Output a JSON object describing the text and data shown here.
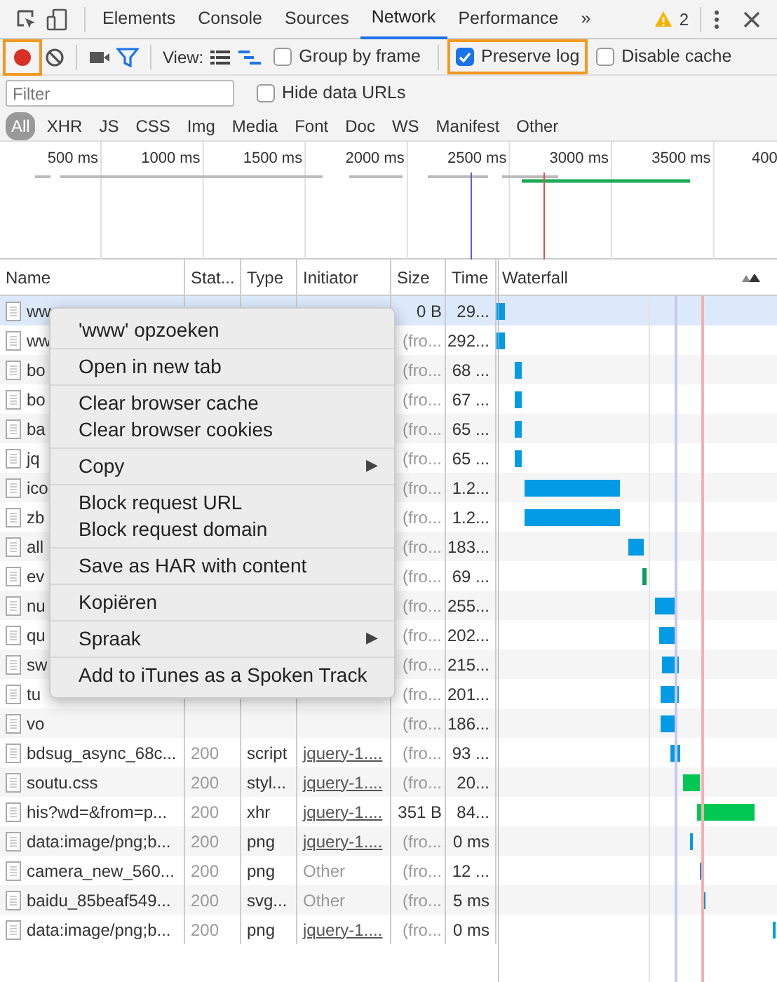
{
  "tabs": [
    {
      "label": "Elements",
      "selected": false
    },
    {
      "label": "Console",
      "selected": false
    },
    {
      "label": "Sources",
      "selected": false
    },
    {
      "label": "Network",
      "selected": true
    },
    {
      "label": "Performance",
      "selected": false
    }
  ],
  "more_tabs": "»",
  "warning_count": "2",
  "toolbar": {
    "record": {
      "highlighted": true
    },
    "view_label": "View:",
    "checkboxes": [
      {
        "label": "Group by frame",
        "checked": false,
        "highlighted": false
      },
      {
        "label": "Preserve log",
        "checked": true,
        "highlighted": true
      },
      {
        "label": "Disable cache",
        "checked": false,
        "highlighted": false
      }
    ]
  },
  "filter": {
    "placeholder": "Filter",
    "hide_data_urls": {
      "label": "Hide data URLs",
      "checked": false
    }
  },
  "type_filters": [
    {
      "label": "All",
      "selected": true
    },
    {
      "label": "XHR",
      "selected": false
    },
    {
      "label": "JS",
      "selected": false
    },
    {
      "label": "CSS",
      "selected": false
    },
    {
      "label": "Img",
      "selected": false
    },
    {
      "label": "Media",
      "selected": false
    },
    {
      "label": "Font",
      "selected": false
    },
    {
      "label": "Doc",
      "selected": false
    },
    {
      "label": "WS",
      "selected": false
    },
    {
      "label": "Manifest",
      "selected": false
    },
    {
      "label": "Other",
      "selected": false
    }
  ],
  "overview": {
    "ticks": [
      "500 ms",
      "1000 ms",
      "1500 ms",
      "2000 ms",
      "2500 ms",
      "3000 ms",
      "3500 ms",
      "400"
    ]
  },
  "table": {
    "columns": [
      "Name",
      "Stat...",
      "Type",
      "Initiator",
      "Size",
      "Time",
      "Waterfall"
    ],
    "rows": [
      {
        "name": "ww",
        "size": "0 B",
        "time": "29...",
        "selected": true
      },
      {
        "name": "ww",
        "size": "(fro...",
        "time": "292...",
        "selected": false
      },
      {
        "name": "bo",
        "size": "(fro...",
        "time": "68 ...",
        "selected": false
      },
      {
        "name": "bo",
        "size": "(fro...",
        "time": "67 ...",
        "selected": false
      },
      {
        "name": "ba",
        "size": "(fro...",
        "time": "65 ...",
        "selected": false
      },
      {
        "name": "jq",
        "size": "(fro...",
        "time": "65 ...",
        "selected": false
      },
      {
        "name": "ico",
        "size": "(fro...",
        "time": "1.2...",
        "selected": false
      },
      {
        "name": "zb",
        "size": "(fro...",
        "time": "1.2...",
        "selected": false
      },
      {
        "name": "all",
        "size": "(fro...",
        "time": "183...",
        "selected": false
      },
      {
        "name": "ev",
        "size": "(fro...",
        "time": "69 ...",
        "selected": false
      },
      {
        "name": "nu",
        "size": "(fro...",
        "time": "255...",
        "selected": false
      },
      {
        "name": "qu",
        "size": "(fro...",
        "time": "202...",
        "selected": false
      },
      {
        "name": "sw",
        "size": "(fro...",
        "time": "215...",
        "selected": false
      },
      {
        "name": "tu",
        "size": "(fro...",
        "time": "201...",
        "selected": false
      },
      {
        "name": "vo",
        "size": "(fro...",
        "time": "186...",
        "selected": false
      },
      {
        "name": "bdsug_async_68c...",
        "status": "200",
        "type": "script",
        "initiator": "jquery-1....",
        "size": "(fro...",
        "time": "93 ...",
        "selected": false
      },
      {
        "name": "soutu.css",
        "status": "200",
        "type": "styl...",
        "initiator": "jquery-1....",
        "size": "(fro...",
        "time": "20...",
        "selected": false
      },
      {
        "name": "his?wd=&from=p...",
        "status": "200",
        "type": "xhr",
        "initiator": "jquery-1....",
        "size": "351 B",
        "time": "84...",
        "selected": false
      },
      {
        "name": "data:image/png;b...",
        "status": "200",
        "type": "png",
        "initiator": "jquery-1....",
        "size": "(fro...",
        "time": "0 ms",
        "selected": false
      },
      {
        "name": "camera_new_560...",
        "status": "200",
        "type": "png",
        "initiator": "Other",
        "size": "(fro...",
        "time": "12 ...",
        "selected": false
      },
      {
        "name": "baidu_85beaf549...",
        "status": "200",
        "type": "svg...",
        "initiator": "Other",
        "size": "(fro...",
        "time": "5 ms",
        "selected": false
      },
      {
        "name": "data:image/png;b...",
        "status": "200",
        "type": "png",
        "initiator": "jquery-1....",
        "size": "(fro...",
        "time": "0 ms",
        "selected": false
      }
    ]
  },
  "context_menu": {
    "groups": [
      {
        "items": [
          {
            "label": "'www' opzoeken",
            "has_submenu": false
          }
        ]
      },
      {
        "items": [
          {
            "label": "Open in new tab",
            "has_submenu": false
          }
        ]
      },
      {
        "items": [
          {
            "label": "Clear browser cache",
            "has_submenu": false
          },
          {
            "label": "Clear browser cookies",
            "has_submenu": false
          }
        ]
      },
      {
        "items": [
          {
            "label": "Copy",
            "has_submenu": true
          }
        ]
      },
      {
        "items": [
          {
            "label": "Block request URL",
            "has_submenu": false
          },
          {
            "label": "Block request domain",
            "has_submenu": false
          }
        ]
      },
      {
        "items": [
          {
            "label": "Save as HAR with content",
            "has_submenu": false
          }
        ]
      },
      {
        "items": [
          {
            "label": "Kopiëren",
            "has_submenu": false
          }
        ]
      },
      {
        "items": [
          {
            "label": "Spraak",
            "has_submenu": true
          }
        ]
      },
      {
        "items": [
          {
            "label": "Add to iTunes as a Spoken Track",
            "has_submenu": false
          }
        ]
      }
    ],
    "submenu_arrow": "▶"
  }
}
